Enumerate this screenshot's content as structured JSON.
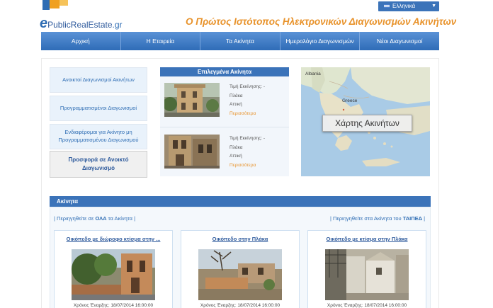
{
  "header": {
    "logo_e": "e",
    "logo_text": "PublicRealEstate",
    "logo_tld": ".gr",
    "slogan": "Ο Πρώτος Ιστότοπος Ηλεκτρονικών Διαγωνισμών Ακινήτων",
    "language": "Ελληνικά"
  },
  "nav": [
    {
      "label": "Αρχική"
    },
    {
      "label": "Η Εταιρεία"
    },
    {
      "label": "Τα Ακίνητα"
    },
    {
      "label": "Ημερολόγιο Διαγωνισμών"
    },
    {
      "label": "Νέοι Διαγωνισμοί"
    }
  ],
  "left_buttons": [
    {
      "label": "Ανοικτοί Διαγωνισμοί Ακινήτων"
    },
    {
      "label": "Προγραμματισμένοι Διαγωνισμοί"
    },
    {
      "label": "Ενδιαφέρομαι για Ακίνητο μη Προγραμματισμένου Διαγωνισμού"
    },
    {
      "label": "Προσφορά σε Ανοικτό Διαγωνισμό"
    }
  ],
  "featured": {
    "title": "Επιλεγμένα Ακίνητα",
    "items": [
      {
        "price": "Τιμή Εκκίνησης: -",
        "area": "Πλάκα",
        "region": "Αττική",
        "more": "Περισσότερα"
      },
      {
        "price": "Τιμή Εκκίνησης: -",
        "area": "Πλάκα",
        "region": "Αττική",
        "more": "Περισσότερα"
      }
    ]
  },
  "map": {
    "label": "Χάρτης Ακινήτων",
    "country_albania": "Albania",
    "country_greece": "Greece"
  },
  "properties": {
    "header": "Ακίνητα",
    "browse_all_prefix": "| Περιηγηθείτε σε ",
    "browse_all_bold": "ΟΛΑ",
    "browse_all_suffix": " τα Ακίνητα |",
    "browse_taiped_prefix": "| Περιηγηθείτε στα Ακίνητα του ",
    "browse_taiped_bold": "ΤΑΙΠΕΔ",
    "browse_taiped_suffix": " |",
    "cards": [
      {
        "title": "Οικόπεδο με διώροφο κτίσμα στην ...",
        "date": "Χρόνος Έναρξης: 18/07/2014 16:00:00"
      },
      {
        "title": "Οικόπεδο στην Πλάκα",
        "date": "Χρόνος Έναρξης: 18/07/2014 16:00:00"
      },
      {
        "title": "Οικόπεδο με κτίσμα στην Πλάκα",
        "date": "Χρόνος Έναρξης: 18/07/2014 16:00:00"
      }
    ]
  }
}
